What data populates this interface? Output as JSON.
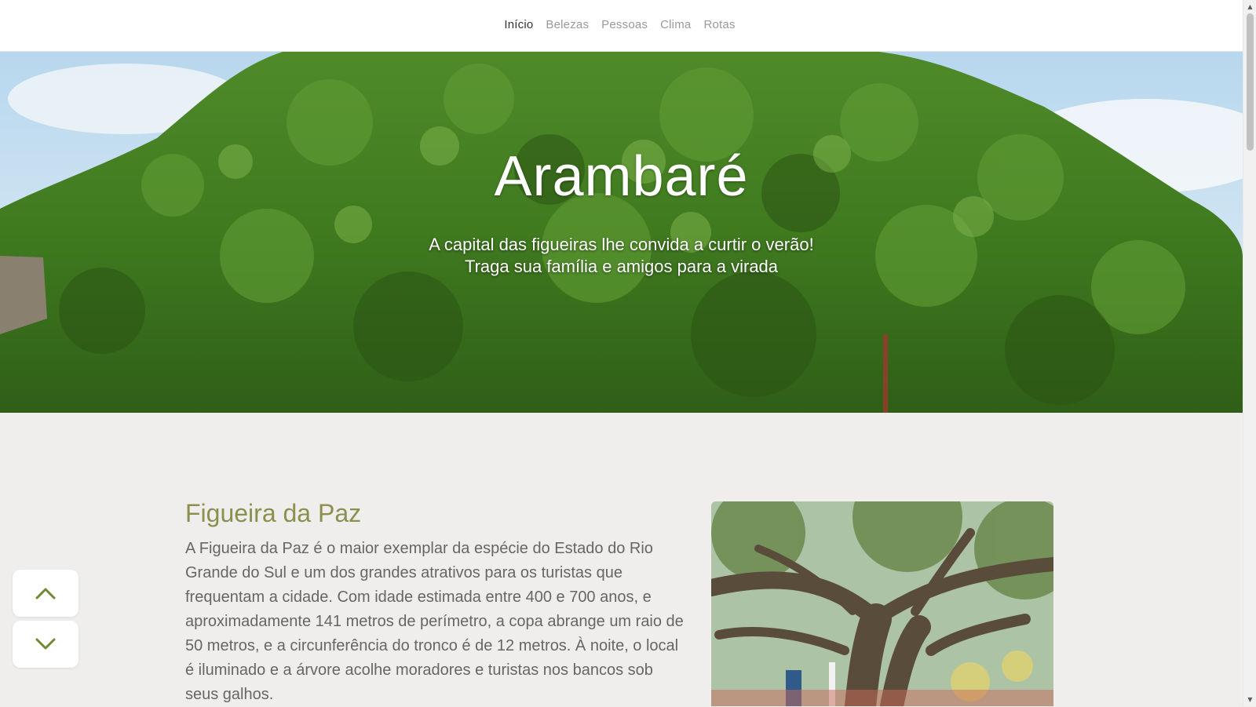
{
  "nav": {
    "items": [
      {
        "label": "Início",
        "active": true
      },
      {
        "label": "Belezas",
        "active": false
      },
      {
        "label": "Pessoas",
        "active": false
      },
      {
        "label": "Clima",
        "active": false
      },
      {
        "label": "Rotas",
        "active": false
      }
    ]
  },
  "hero": {
    "title": "Arambaré",
    "subtitle_line1": "A capital das figueiras lhe convida a curtir o verão!",
    "subtitle_line2": "Traga sua família e amigos para a virada"
  },
  "article": {
    "title": "Figueira da Paz",
    "text": "A Figueira da Paz é o maior exemplar da espécie do Estado do Rio Grande do Sul e um dos grandes atrativos para os turistas que frequentam a cidade. Com idade estimada entre 400 e 700 anos, e aproximadamente 141 metros de perímetro, a copa abrange um raio de 50 metros, e a circunferência do tronco é de 12 metros. À noite, o local é iluminado e a árvore acolhe moradores e turistas nos bancos sob seus galhos."
  },
  "controls": {
    "scroll_up_icon": "chevron-up-icon",
    "scroll_down_icon": "chevron-down-icon"
  },
  "colors": {
    "accent": "#8c8f4e",
    "icon": "#7a8a3a",
    "background": "#efeeec",
    "text": "#666666"
  }
}
